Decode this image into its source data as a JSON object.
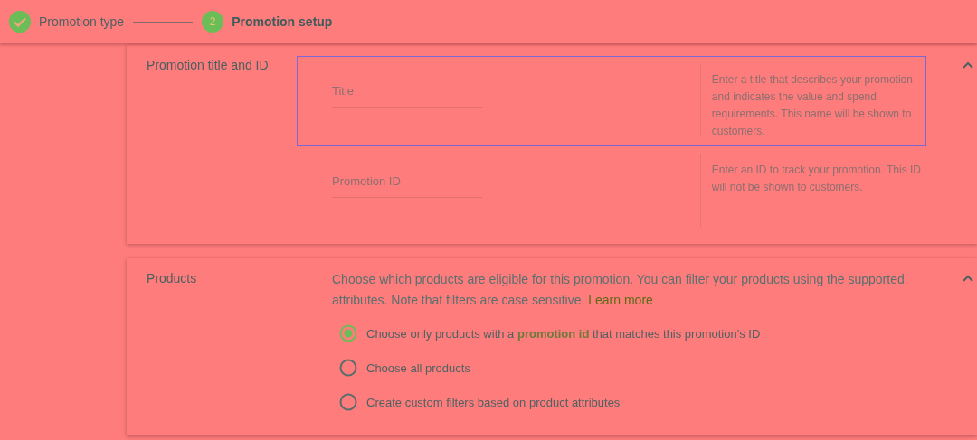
{
  "stepper": {
    "steps": [
      {
        "label": "Promotion type",
        "done": true,
        "current": false
      },
      {
        "label": "Promotion setup",
        "done": false,
        "current": true,
        "number": "2"
      }
    ]
  },
  "title_section": {
    "heading": "Promotion title and ID",
    "expanded": true,
    "fields": [
      {
        "placeholder": "Title",
        "focused": true,
        "help": "Enter a title that describes your promotion and indicates the value and spend requirements. This name will be shown to customers."
      },
      {
        "placeholder": "Promotion ID",
        "focused": false,
        "help": "Enter an ID to track your promotion. This ID will not be shown to customers."
      }
    ]
  },
  "products_section": {
    "heading": "Products",
    "expanded": true,
    "description": "Choose which products are eligible for this promotion. You can filter your products using the supported attributes. Note that filters are case sensitive.",
    "link": "Learn more",
    "options": [
      {
        "label": "Choose only products with a **promotion id** that matches this promotion's ID",
        "selected": true
      },
      {
        "label": "Choose all products",
        "selected": false
      },
      {
        "label": "Create custom filters based on product attributes",
        "selected": false
      }
    ]
  }
}
